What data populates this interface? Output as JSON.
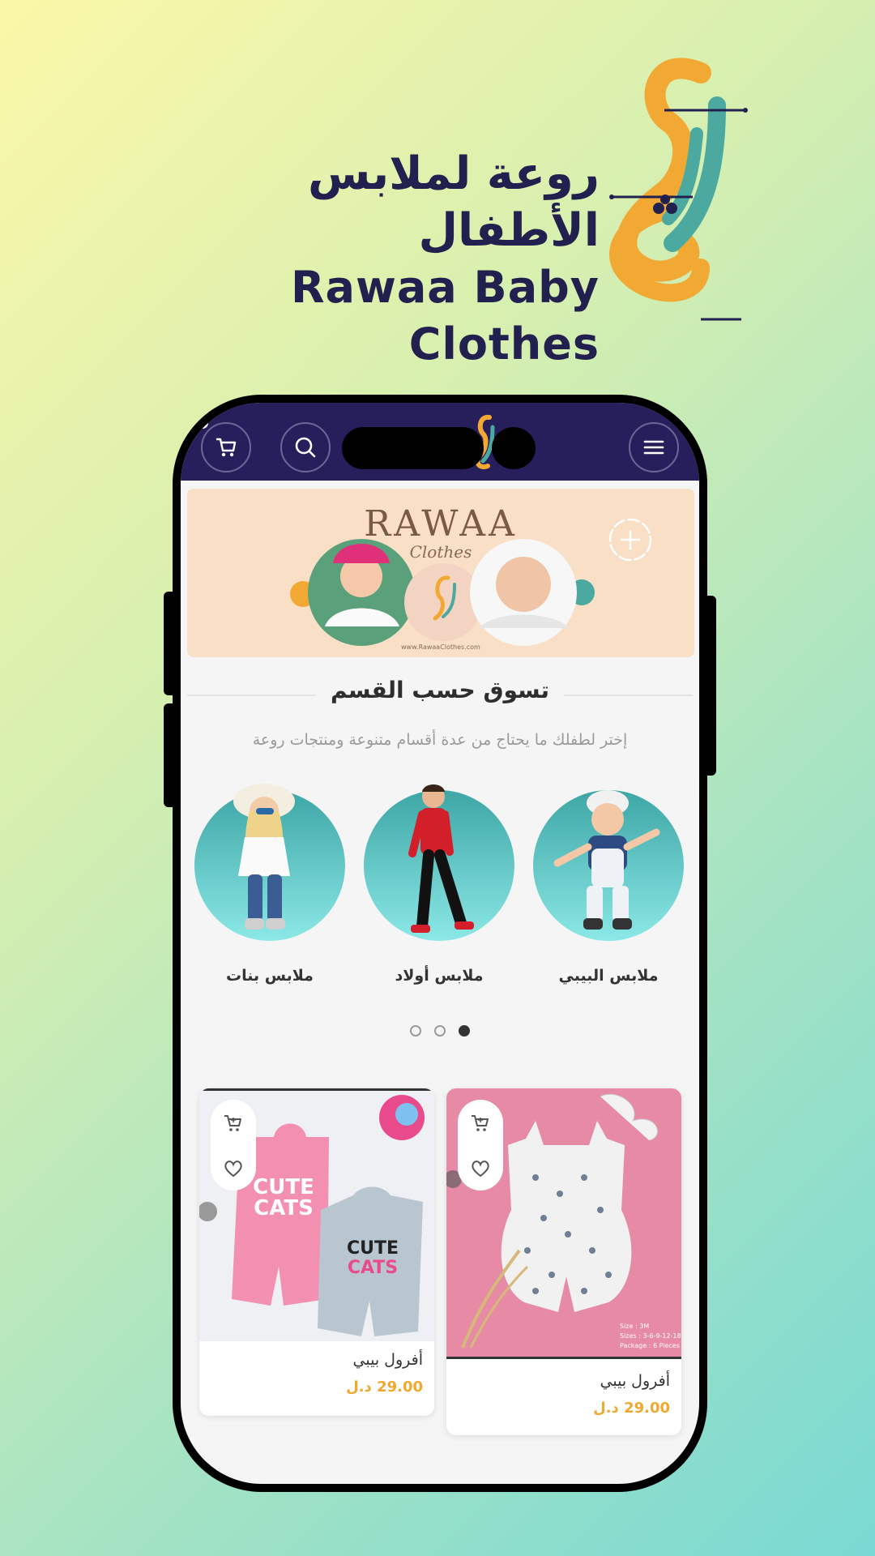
{
  "brand": {
    "name_ar": "روعة لملابس الأطفال",
    "name_en": "Rawaa Baby Clothes",
    "colors": {
      "navy": "#22204f",
      "orange": "#f2a934",
      "teal": "#4ba9a0"
    }
  },
  "topbar": {
    "cart_icon": "cart-icon",
    "search_icon": "search-icon",
    "menu_icon": "hamburger-icon",
    "background": "#261f5b"
  },
  "banner": {
    "title": "RAWAA",
    "subtitle": "Clothes",
    "url": "www.RawaaClothes.com"
  },
  "section": {
    "title": "تسوق حسب القسم",
    "subtitle": "إختر لطفلك ما يحتاج من عدة أقسام متنوعة ومنتجات روعة"
  },
  "categories": [
    {
      "label": "ملابس البيبي"
    },
    {
      "label": "ملابس أولاد"
    },
    {
      "label": "ملابس بنات"
    }
  ],
  "carousel": {
    "count": 3,
    "active_from_right": 1
  },
  "products": [
    {
      "name": "أفرول بيبي",
      "price": "29.00 د.ل",
      "print1": "CUTE",
      "print2": "CATS"
    },
    {
      "name": "أفرول بيبي",
      "price": "29.00 د.ل",
      "tag_line1": "Size : 3M",
      "tag_line2": "Sizes : 3-6-9-12-18",
      "tag_line3": "Package : 6 Pieces"
    }
  ]
}
